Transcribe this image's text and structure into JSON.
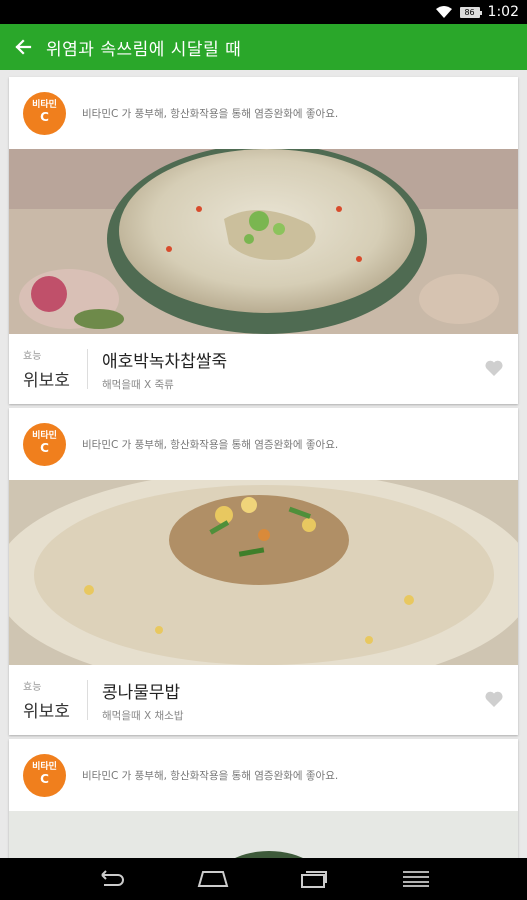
{
  "status_bar": {
    "time": "1:02",
    "battery": "86",
    "wifi_icon": "wifi-icon"
  },
  "app_bar": {
    "back_icon": "arrow-back-icon",
    "title": "위염과 속쓰림에 시달릴 때"
  },
  "cards": [
    {
      "badge_line1": "비타민",
      "badge_line2": "C",
      "description": "비타민C 가 풍부해, 항산화작용을 통해 염증완화에 좋아요.",
      "effect_label": "효능",
      "effect_value": "위보호",
      "dish_name": "애호박녹차찹쌀죽",
      "dish_meta": "해먹을때 X 죽류",
      "favorite_icon": "heart-icon"
    },
    {
      "badge_line1": "비타민",
      "badge_line2": "C",
      "description": "비타민C 가 풍부해, 항산화작용을 통해 염증완화에 좋아요.",
      "effect_label": "효능",
      "effect_value": "위보호",
      "dish_name": "콩나물무밥",
      "dish_meta": "해먹을때 X 채소밥",
      "favorite_icon": "heart-icon"
    },
    {
      "badge_line1": "비타민",
      "badge_line2": "C",
      "description": "비타민C 가 풍부해, 항산화작용을 통해 염증완화에 좋아요."
    }
  ],
  "nav_bar": {
    "back": "nav-back-icon",
    "home": "nav-home-icon",
    "recents": "nav-recents-icon",
    "menu": "nav-menu-icon"
  },
  "colors": {
    "app_bar": "#2aa72a",
    "badge": "#f07f1d"
  }
}
